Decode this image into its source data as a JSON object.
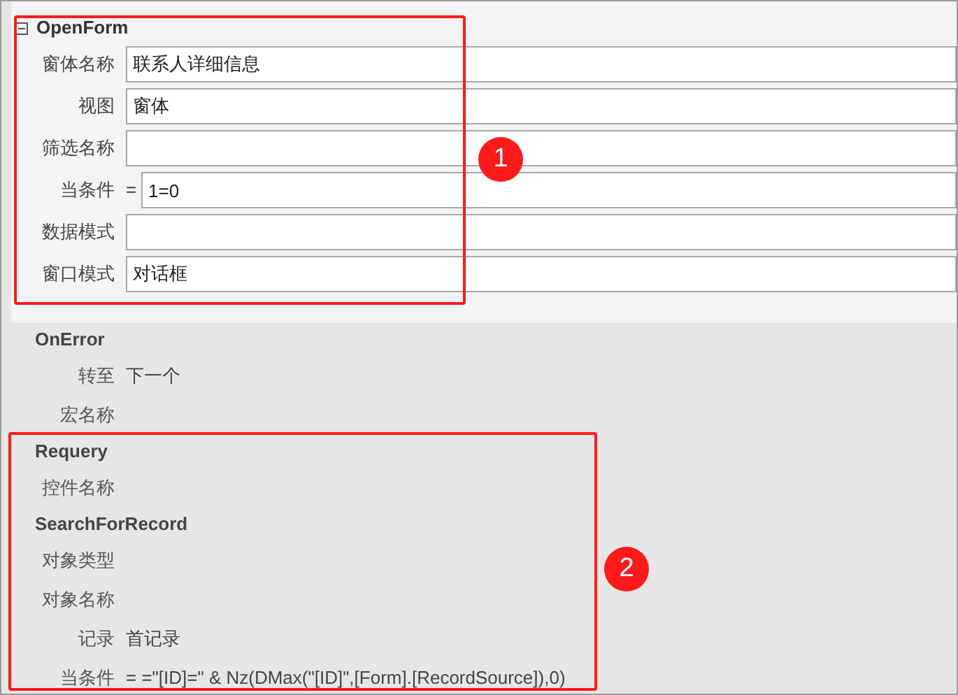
{
  "actions": [
    {
      "name": "OpenForm",
      "selected": true,
      "arguments": [
        {
          "label": "窗体名称",
          "value": "联系人详细信息"
        },
        {
          "label": "视图",
          "value": "窗体"
        },
        {
          "label": "筛选名称"
        },
        {
          "label": "当条件",
          "prefix": "=",
          "value": "1=0"
        },
        {
          "label": "数据模式"
        },
        {
          "label": "窗口模式",
          "value": "对话框"
        }
      ]
    },
    {
      "name": "OnError",
      "selected": false,
      "arguments": [
        {
          "label": "转至",
          "value": "下一个"
        },
        {
          "label": "宏名称"
        }
      ]
    },
    {
      "name": "Requery",
      "selected": false,
      "arguments": [
        {
          "label": "控件名称"
        }
      ]
    },
    {
      "name": "SearchForRecord",
      "selected": false,
      "arguments": [
        {
          "label": "对象类型"
        },
        {
          "label": "对象名称"
        },
        {
          "label": "记录",
          "value": "首记录"
        },
        {
          "label": "当条件",
          "value": "= =\"[ID]=\" & Nz(DMax(\"[ID]\",[Form].[RecordSource]),0)"
        }
      ]
    }
  ],
  "annotations": [
    {
      "label": "1"
    },
    {
      "label": "2"
    }
  ]
}
